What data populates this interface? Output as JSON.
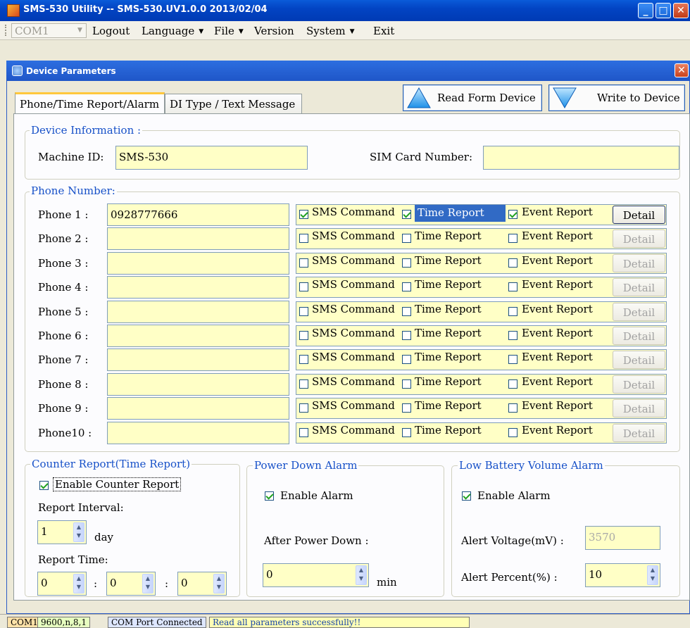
{
  "window": {
    "title": "SMS-530 Utility -- SMS-530.UV1.0.0 2013/02/04"
  },
  "menubar": {
    "port_combo": "COM1",
    "items": [
      {
        "label": "Logout",
        "dropdown": false
      },
      {
        "label": "Language",
        "dropdown": true
      },
      {
        "label": "File",
        "dropdown": true
      },
      {
        "label": "Version",
        "dropdown": false
      },
      {
        "label": "System",
        "dropdown": true
      },
      {
        "label": "Exit",
        "dropdown": false
      }
    ]
  },
  "dialog": {
    "title": "Device Parameters"
  },
  "tabs": [
    "Phone/Time Report/Alarm",
    "DI Type / Text Message"
  ],
  "actions": {
    "read": "Read Form Device",
    "write": "Write to Device"
  },
  "device_info": {
    "legend": "Device Information :",
    "machine_id_label": "Machine ID:",
    "machine_id": "SMS-530",
    "sim_label": "SIM Card Number:",
    "sim_number": ""
  },
  "phones": {
    "legend": "Phone Number:",
    "option_labels": {
      "sms": "SMS Command",
      "time": "Time Report",
      "event": "Event Report",
      "detail": "Detail"
    },
    "rows": [
      {
        "label": "Phone 1 :",
        "number": "0928777666",
        "sms": true,
        "time": true,
        "event": true,
        "detail_enabled": true
      },
      {
        "label": "Phone 2 :",
        "number": "",
        "sms": false,
        "time": false,
        "event": false,
        "detail_enabled": false
      },
      {
        "label": "Phone 3 :",
        "number": "",
        "sms": false,
        "time": false,
        "event": false,
        "detail_enabled": false
      },
      {
        "label": "Phone 4 :",
        "number": "",
        "sms": false,
        "time": false,
        "event": false,
        "detail_enabled": false
      },
      {
        "label": "Phone 5 :",
        "number": "",
        "sms": false,
        "time": false,
        "event": false,
        "detail_enabled": false
      },
      {
        "label": "Phone 6 :",
        "number": "",
        "sms": false,
        "time": false,
        "event": false,
        "detail_enabled": false
      },
      {
        "label": "Phone 7 :",
        "number": "",
        "sms": false,
        "time": false,
        "event": false,
        "detail_enabled": false
      },
      {
        "label": "Phone 8 :",
        "number": "",
        "sms": false,
        "time": false,
        "event": false,
        "detail_enabled": false
      },
      {
        "label": "Phone 9 :",
        "number": "",
        "sms": false,
        "time": false,
        "event": false,
        "detail_enabled": false
      },
      {
        "label": "Phone10 :",
        "number": "",
        "sms": false,
        "time": false,
        "event": false,
        "detail_enabled": false
      }
    ]
  },
  "counter_report": {
    "legend": "Counter Report(Time Report)",
    "enable_label": "Enable Counter Report",
    "enabled": true,
    "interval_label": "Report Interval:",
    "interval_value": "1",
    "interval_unit": "day",
    "time_label": "Report Time:",
    "hour": "0",
    "minute": "0",
    "second": "0",
    "separator": ":"
  },
  "power_down": {
    "legend": "Power Down Alarm",
    "enable_label": "Enable Alarm",
    "enabled": true,
    "after_label": "After Power Down :",
    "value": "0",
    "unit": "min"
  },
  "low_battery": {
    "legend": "Low Battery Volume Alarm",
    "enable_label": "Enable Alarm",
    "enabled": true,
    "voltage_label": "Alert Voltage(mV) :",
    "voltage_value": "3570",
    "percent_label": "Alert Percent(%)   :",
    "percent_value": "10"
  },
  "status": {
    "port": "COM1",
    "settings": "9600,n,8,1",
    "connection": "COM Port Connected",
    "message": "Read all parameters successfully!!"
  },
  "colors": {
    "field_bg": "#ffffc6",
    "legend": "#1650c8",
    "titlebar": "#0244c3",
    "selection": "#316ac5"
  }
}
